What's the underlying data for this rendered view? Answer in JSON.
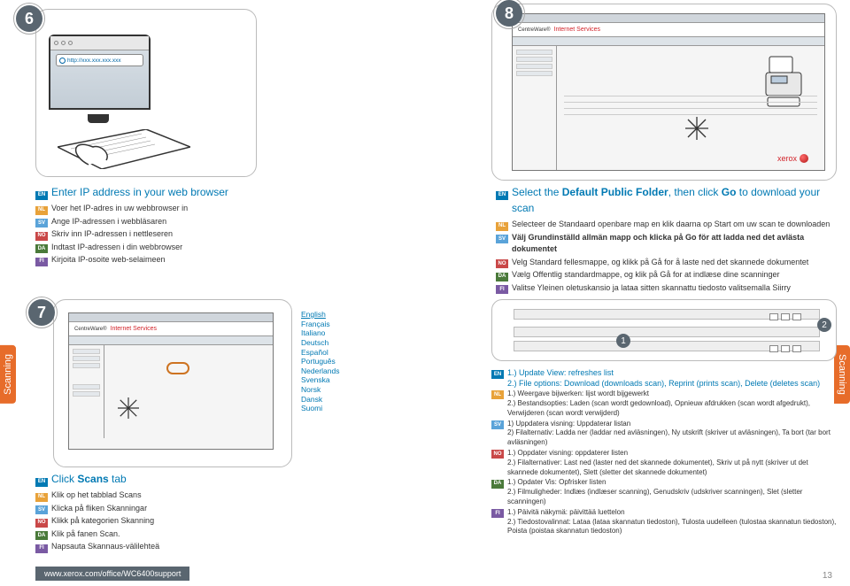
{
  "steps": {
    "s6": "6",
    "s7": "7",
    "s8": "8"
  },
  "url_text": "http://xxx.xxx.xxx.xxx",
  "internet_services": "Internet Services",
  "centreware": "CentreWare®",
  "xerox": "xerox",
  "languages": [
    "English",
    "Français",
    "Italiano",
    "Deutsch",
    "Español",
    "Português",
    "Nederlands",
    "Svenska",
    "Norsk",
    "Dansk",
    "Suomi"
  ],
  "step6": {
    "en": "Enter IP address in your web browser",
    "nl": "Voer het IP-adres in uw webbrowser in",
    "sv": "Ange IP-adressen i webbläsaren",
    "no": "Skriv inn IP-adressen i nettleseren",
    "da": "Indtast IP-adressen i din webbrowser",
    "fi": "Kirjoita IP-osoite web-selaimeen"
  },
  "step8": {
    "en_a": "Select the ",
    "en_b": "Default Public Folder",
    "en_c": ", then click ",
    "en_d": "Go",
    "en_e": " to download your scan",
    "nl": "Selecteer de Standaard openbare map en klik daarna op Start om uw scan te downloaden",
    "sv": "Välj Grundinställd allmän mapp och klicka på Go för att ladda ned det avlästa dokumentet",
    "no": "Velg Standard fellesmappe, og klikk på Gå for å laste ned det skannede dokumentet",
    "da": "Vælg Offentlig standardmappe, og klik på Gå for at indlæse dine scanninger",
    "fi": "Valitse Yleinen oletuskansio ja lataa sitten skannattu tiedosto valitsemalla Siirry"
  },
  "step7": {
    "en_a": "Click ",
    "en_b": "Scans",
    "en_c": " tab",
    "nl": "Klik op het tabblad Scans",
    "sv": "Klicka på fliken Skanningar",
    "no": "Klikk på kategorien Skanning",
    "da": "Klik på fanen Scan.",
    "fi": "Napsauta Skannaus-välilehteä"
  },
  "notes": {
    "c1": "1",
    "c2": "2",
    "en1": "1.) Update View: refreshes list",
    "en2": "2.) File options: Download (downloads scan), Reprint (prints scan), Delete (deletes scan)",
    "nl": "1.) Weergave bijwerken: lijst wordt bijgewerkt\n2.) Bestandsopties: Laden (scan wordt gedownload), Opnieuw afdrukken (scan wordt afgedrukt), Verwijderen (scan wordt verwijderd)",
    "sv": "1) Uppdatera visning: Uppdaterar listan\n2) Filalternativ: Ladda ner (laddar ned avläsningen), Ny utskrift (skriver ut avläsningen), Ta bort (tar bort avläsningen)",
    "no": "1.) Oppdater visning: oppdaterer listen\n2.) Filalternativer: Last ned (laster ned det skannede dokumentet), Skriv ut på nytt (skriver ut det skannede dokumentet), Slett (sletter det skannede dokumentet)",
    "da": "1.) Opdater Vis: Opfrisker listen\n2.) Filmuligheder: Indlæs (indlæser scanning), Genudskriv (udskriver scanningen), Slet (sletter scanningen)",
    "fi": "1.) Päivitä näkymä: päivittää luettelon\n2.) Tiedostovalinnat: Lataa (lataa skannatun tiedoston), Tulosta uudelleen (tulostaa skannatun tiedoston), Poista (poistaa skannatun tiedoston)"
  },
  "side_tab": "Scanning",
  "footer_url": "www.xerox.com/office/WC6400support",
  "page_num": "13"
}
